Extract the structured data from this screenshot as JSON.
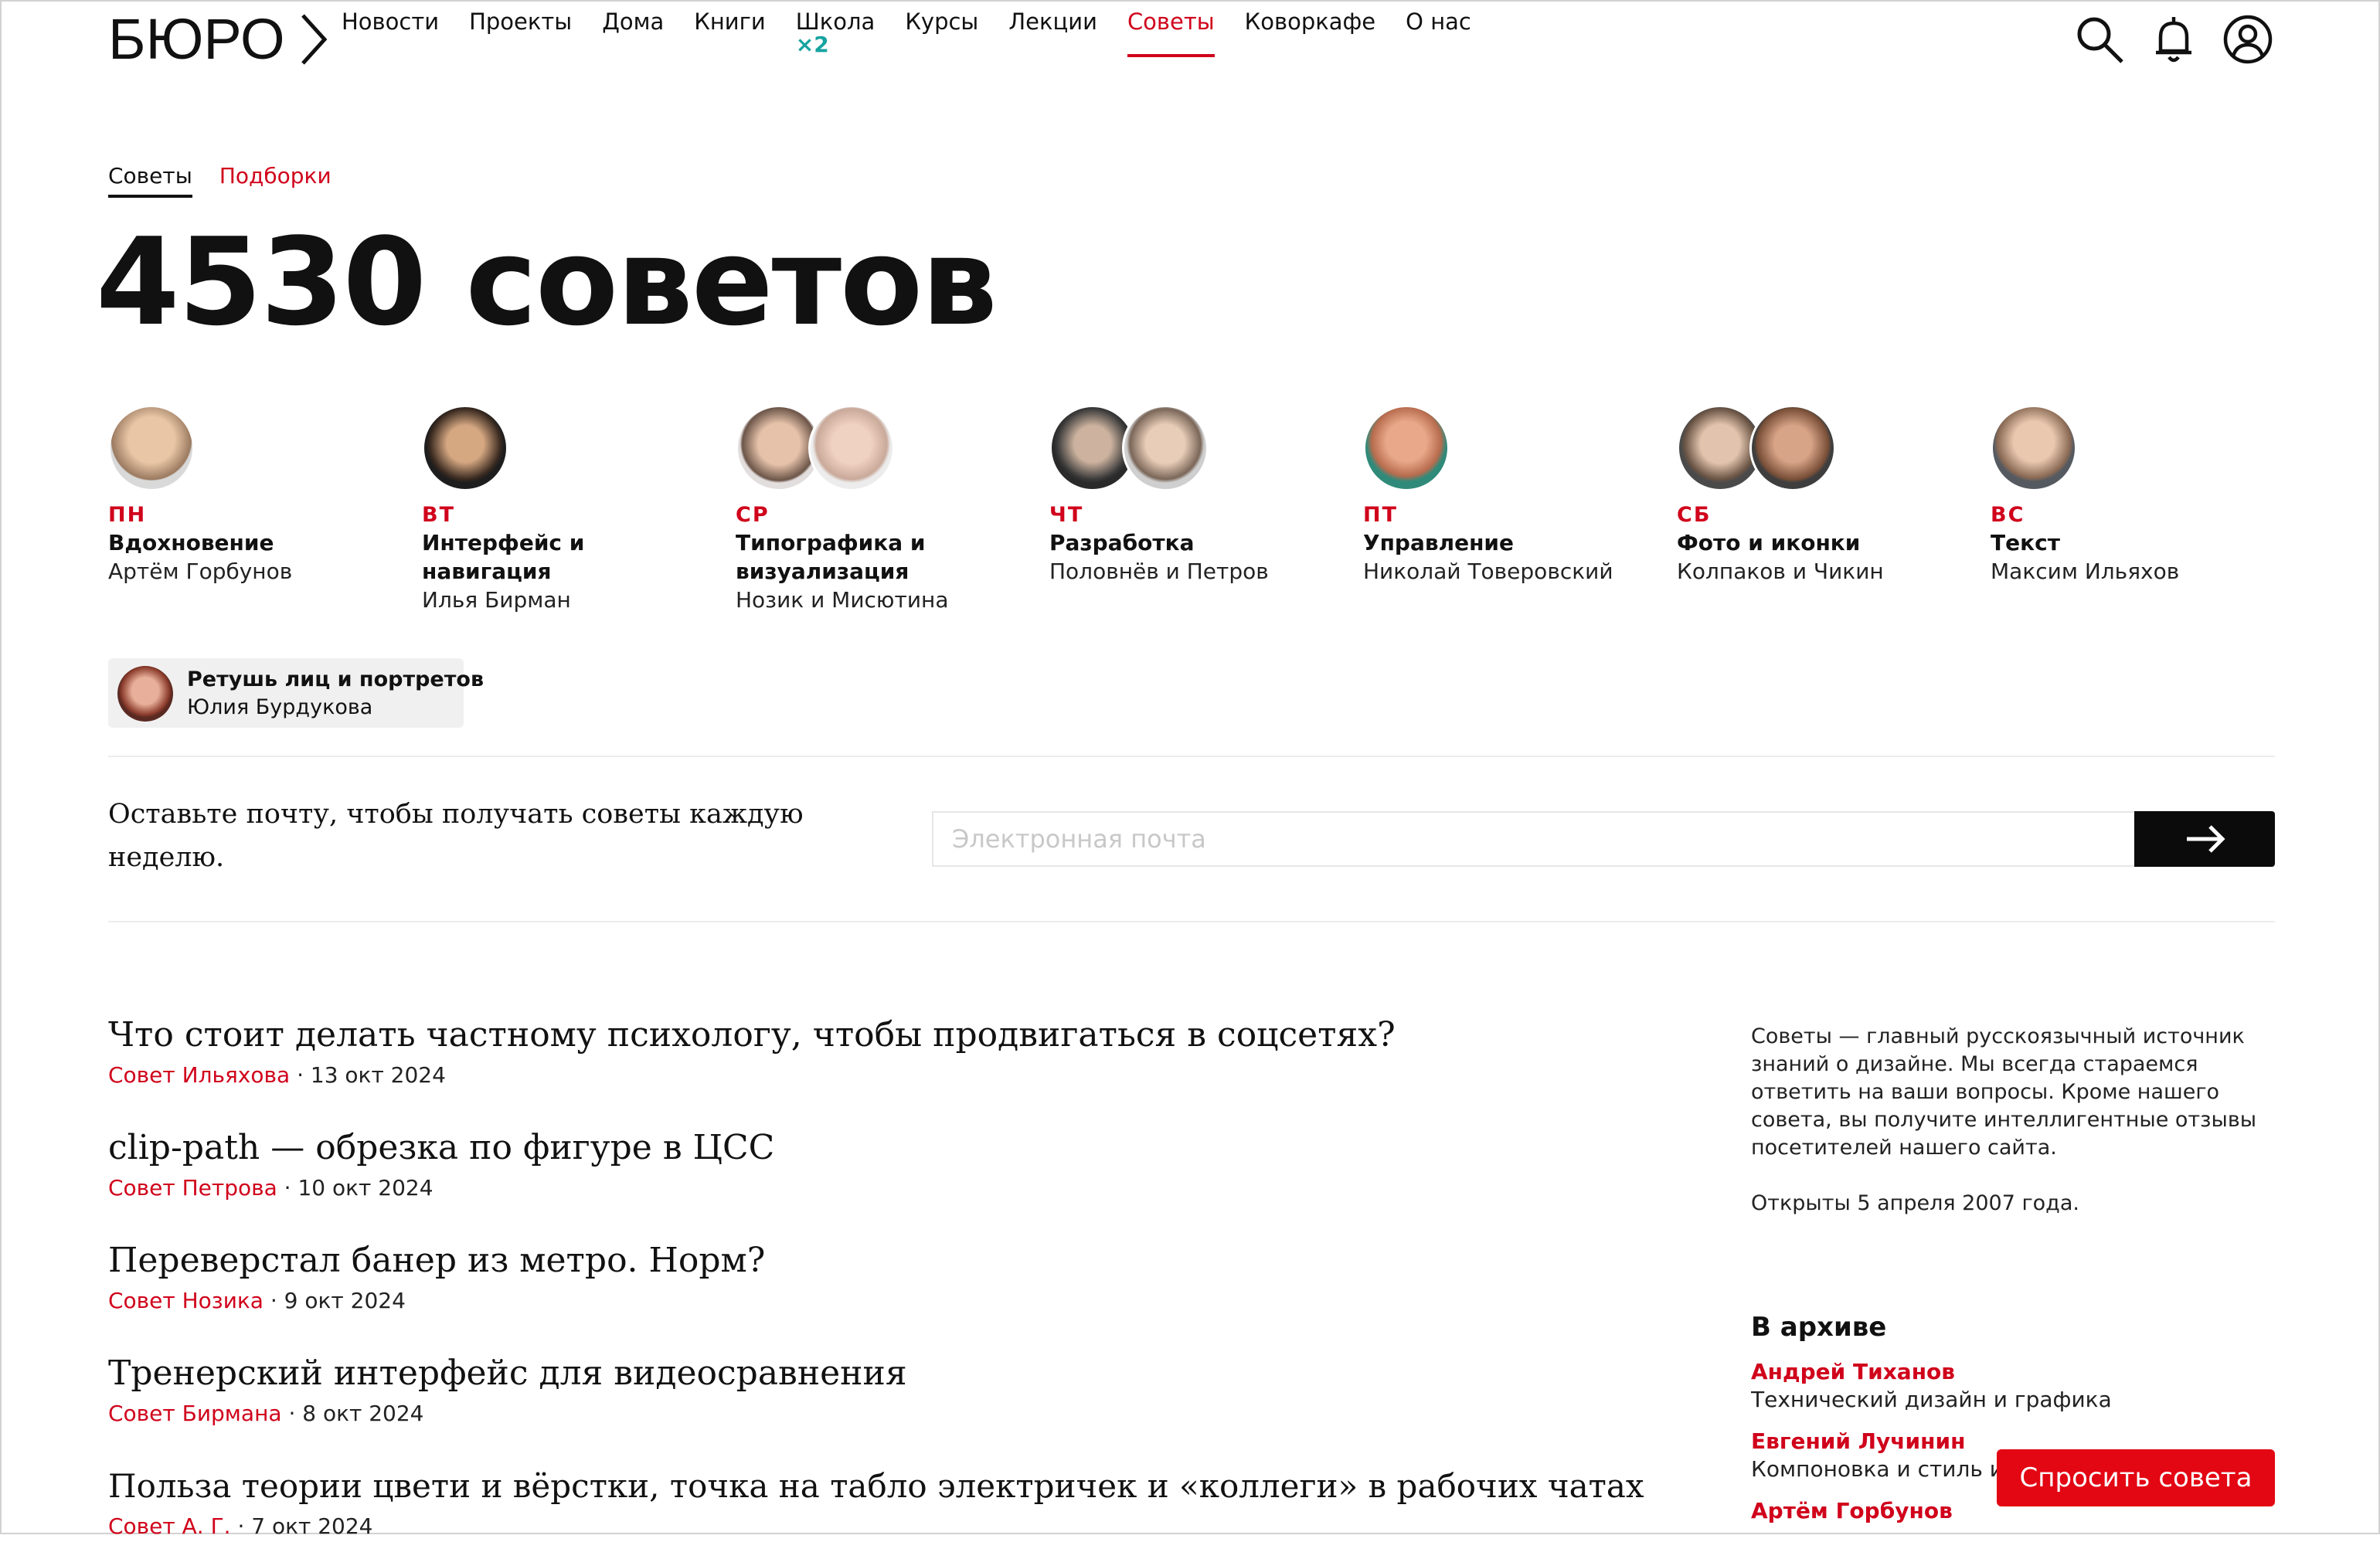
{
  "header": {
    "logo_text": "БЮРО",
    "nav": [
      {
        "label": "Новости"
      },
      {
        "label": "Проекты"
      },
      {
        "label": "Дома"
      },
      {
        "label": "Книги"
      },
      {
        "label": "Школа",
        "badge": "×2"
      },
      {
        "label": "Курсы"
      },
      {
        "label": "Лекции"
      },
      {
        "label": "Советы",
        "active": true
      },
      {
        "label": "Коворкафе"
      },
      {
        "label": "О нас"
      }
    ],
    "icons": [
      "search-icon",
      "bell-icon",
      "user-icon"
    ]
  },
  "tabs": [
    {
      "label": "Советы",
      "active": true
    },
    {
      "label": "Подборки",
      "active": false
    }
  ],
  "headline": "4530 советов",
  "days": [
    {
      "day": "ПН",
      "topic": "Вдохновение",
      "author": "Артём Горбунов"
    },
    {
      "day": "ВТ",
      "topic": "Интерфейс и навигация",
      "author": "Илья Бирман"
    },
    {
      "day": "СР",
      "topic": "Типографика и визуализация",
      "author": "Нозик и Мисютина"
    },
    {
      "day": "ЧТ",
      "topic": "Разработка",
      "author": "Половнёв и Петров"
    },
    {
      "day": "ПТ",
      "topic": "Управление",
      "author": "Николай Товеровский"
    },
    {
      "day": "СБ",
      "topic": "Фото и иконки",
      "author": "Колпаков и Чикин"
    },
    {
      "day": "ВС",
      "topic": "Текст",
      "author": "Максим Ильяхов"
    }
  ],
  "special": {
    "topic": "Ретушь лиц и портретов",
    "author": "Юлия Бурдукова"
  },
  "subscribe": {
    "text": "Оставьте почту, чтобы получать советы каждую неделю.",
    "placeholder": "Электронная почта"
  },
  "articles": [
    {
      "title": "Что стоит делать частному психологу, чтобы продвигаться в соцсетях?",
      "author": "Совет Ильяхова",
      "date": " · 13 окт 2024"
    },
    {
      "title": "clip-path — обрезка по фигуре в ЦСС",
      "author": "Совет Петрова",
      "date": " · 10 окт 2024"
    },
    {
      "title": "Переверстал банер из метро. Норм?",
      "author": "Совет Нозика",
      "date": " · 9 окт 2024"
    },
    {
      "title": "Тренерский интерфейс для видеосравнения",
      "author": "Совет Бирмана",
      "date": " · 8 окт 2024"
    },
    {
      "title": "Польза теории цвети и вёрстки, точка на табло электричек и «коллеги» в рабочих чатах",
      "author": "Совет А. Г.",
      "date": " · 7 окт 2024"
    }
  ],
  "about": {
    "text": "Советы — главный русскоязычный источник знаний о дизайне. Мы всегда стараемся ответить на ваши вопросы. Кроме нашего совета, вы получите интеллигентные отзывы посетителей нашего сайта.",
    "opened": "Открыты 5 апреля 2007 года."
  },
  "archive": {
    "title": "В архиве",
    "items": [
      {
        "name": "Андрей Тиханов",
        "topic": "Технический дизайн и графика"
      },
      {
        "name": "Евгений Лучинин",
        "topic": "Компоновка и стиль инс"
      },
      {
        "name": "Артём Горбунов",
        "topic": ""
      }
    ]
  },
  "ask_button": "Спросить совета",
  "colors": {
    "accent": "#d0021b",
    "teal_badge": "#16a3a0",
    "ask_button": "#e30613"
  }
}
